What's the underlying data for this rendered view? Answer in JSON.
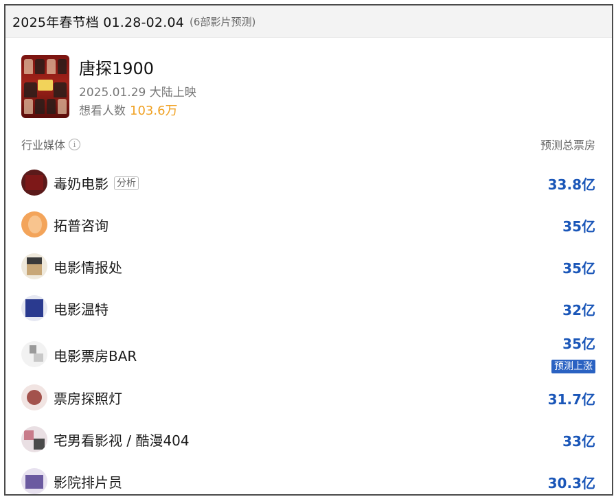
{
  "header": {
    "title": "2025年春节档 01.28-02.04",
    "subtitle": "(6部影片预测)"
  },
  "movie": {
    "name": "唐探1900",
    "release": "2025.01.29 大陆上映",
    "want_label": "想看人数",
    "want_value": "103.6万"
  },
  "table": {
    "col_media": "行业媒体",
    "info_glyph": "i",
    "col_forecast": "预测总票房"
  },
  "rows": [
    {
      "name": "毒奶电影",
      "tag": "分析",
      "value": "33.8亿",
      "badge": ""
    },
    {
      "name": "拓普咨询",
      "tag": "",
      "value": "35亿",
      "badge": ""
    },
    {
      "name": "电影情报处",
      "tag": "",
      "value": "35亿",
      "badge": ""
    },
    {
      "name": "电影温特",
      "tag": "",
      "value": "32亿",
      "badge": ""
    },
    {
      "name": "电影票房BAR",
      "tag": "",
      "value": "35亿",
      "badge": "预测上涨"
    },
    {
      "name": "票房探照灯",
      "tag": "",
      "value": "31.7亿",
      "badge": ""
    },
    {
      "name": "宅男看影视 / 酷漫404",
      "tag": "",
      "value": "33亿",
      "badge": ""
    },
    {
      "name": "影院排片员",
      "tag": "",
      "value": "30.3亿",
      "badge": ""
    }
  ],
  "colors": {
    "value_blue": "#1a56b8",
    "want_orange": "#f0a020",
    "badge_blue": "#2a62c2"
  }
}
